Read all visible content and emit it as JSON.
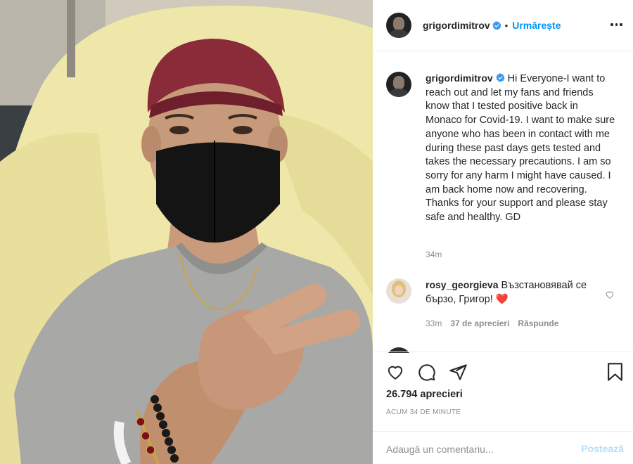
{
  "post": {
    "image_alt": "Selfie in hospital bed wearing maroon cap and black face mask, making a peace sign"
  },
  "header": {
    "username": "grigordimitrov",
    "verified": true,
    "separator": "•",
    "follow_label": "Urmărește",
    "more_icon": "more-options-icon"
  },
  "caption": {
    "username": "grigordimitrov",
    "verified": true,
    "text": "Hi Everyone-I want to reach out and let my fans and friends know that I tested positive back in Monaco for Covid-19. I want to make sure anyone who has been in contact with me during these past days gets tested and takes the necessary precautions. I am so sorry for any harm I might have caused. I am back home now and recovering. Thanks for your support and please stay safe and healthy. GD",
    "time": "34m"
  },
  "comments": [
    {
      "username": "rosy_georgieva",
      "text": "Възстановявай се бързо, Григор!",
      "emoji": "❤️",
      "time": "33m",
      "likes": "37 de aprecieri",
      "reply_label": "Răspunde"
    }
  ],
  "actions": {
    "likes_count": "26.794 aprecieri",
    "posted_ago": "Acum 34 de minute"
  },
  "add_comment": {
    "placeholder": "Adaugă un comentariu...",
    "post_label": "Postează"
  },
  "colors": {
    "accent": "#0095f6",
    "post_disabled": "#b2dffc",
    "muted": "#8e8e8e",
    "text": "#262626",
    "heart": "#e0245e"
  }
}
